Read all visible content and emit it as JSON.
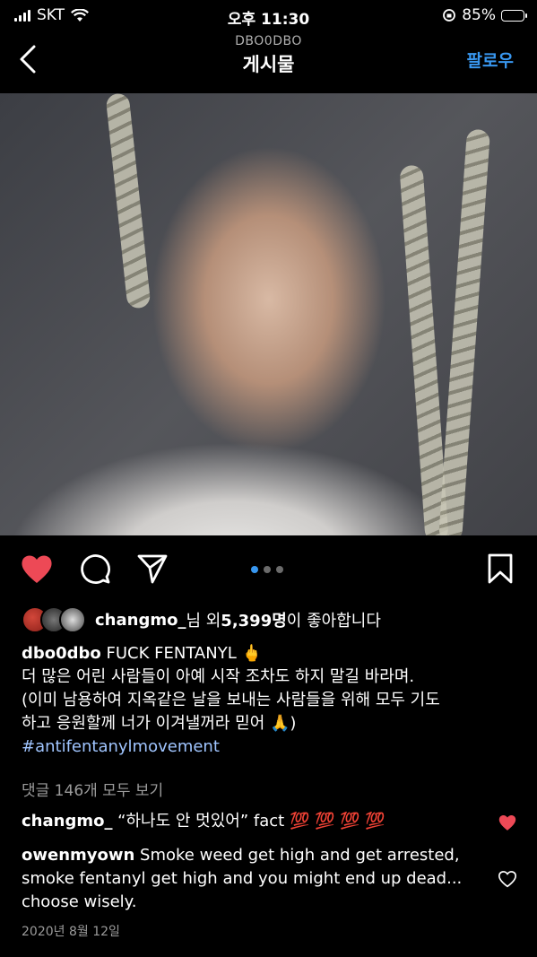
{
  "status_bar": {
    "carrier": "SKT",
    "time": "오후 11:30",
    "battery": "85%",
    "battery_level": 0.85,
    "icons": [
      "signal-bars-icon",
      "wifi-icon",
      "rotation-lock-icon",
      "battery-icon"
    ]
  },
  "nav": {
    "account": "DBO0DBO",
    "title": "게시물",
    "follow_label": "팔로우",
    "back_icon": "chevron-left-icon"
  },
  "media": {
    "carousel_dots": 3,
    "active_index": 0
  },
  "actions": {
    "icons": [
      "heart-filled-icon",
      "comment-icon",
      "share-icon",
      "bookmark-icon"
    ],
    "liked": true,
    "like_color": "#ed4956",
    "accent": "#3897f0"
  },
  "likes": {
    "user": "changmo_",
    "middle": "님 외 ",
    "count": "5,399명",
    "suffix": "이 좋아합니다"
  },
  "caption": {
    "user": "dbo0dbo",
    "line1": " FUCK FENTANYL 🖕",
    "line2": "더 많은 어린 사람들이 아예 시작 조차도 하지 말길 바라며.",
    "line3": "(이미 남용하여 지옥같은 날을 보내는 사람들을 위해 모두 기도",
    "line4": "하고 응원할께 너가 이겨낼꺼라 믿어 🙏)",
    "hashtag": "#antifentanylmovement"
  },
  "view_comments": "댓글 146개 모두 보기",
  "comments": [
    {
      "user": "changmo_",
      "text": " “하나도 안 멋있어” fact 💯 💯 💯 💯",
      "liked": true
    },
    {
      "user": "owenmyown",
      "text": " Smoke weed get high and get arrested, smoke fentanyl get high and you might end up dead... choose wisely.",
      "liked": false
    }
  ],
  "date": "2020년 8월 12일"
}
